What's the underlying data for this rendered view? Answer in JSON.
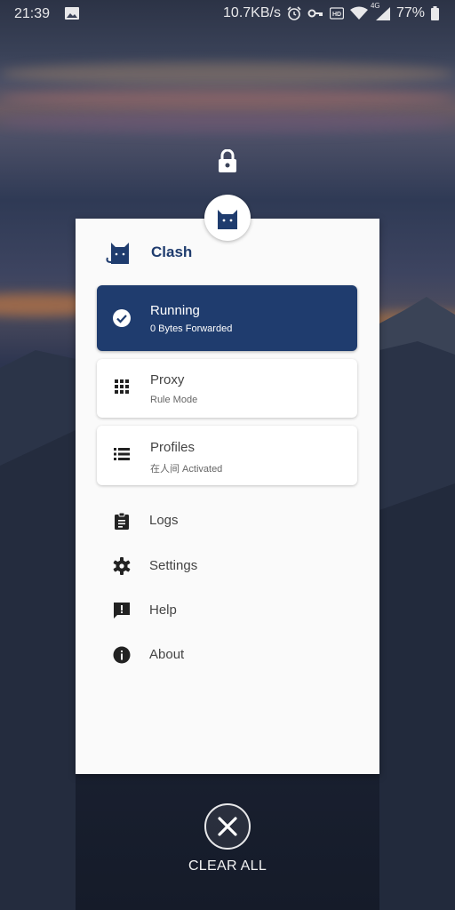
{
  "status_bar": {
    "time": "21:39",
    "network_speed": "10.7KB/s",
    "network_type": "4G",
    "battery": "77%",
    "icons": [
      "image-icon",
      "alarm-icon",
      "vpn-key-icon",
      "hd-icon",
      "wifi-icon",
      "signal-icon",
      "battery-icon"
    ]
  },
  "overview": {
    "lock_icon": "lock-icon",
    "clear_all_label": "CLEAR ALL"
  },
  "app": {
    "title": "Clash",
    "accent_color": "#1f3c6e",
    "status_tile": {
      "title": "Running",
      "subtitle": "0 Bytes Forwarded",
      "icon": "check-circle-icon"
    },
    "proxy_tile": {
      "title": "Proxy",
      "subtitle": "Rule Mode",
      "icon": "grid-icon"
    },
    "profiles_tile": {
      "title": "Profiles",
      "subtitle": "在人间 Activated",
      "icon": "list-icon"
    },
    "menu": [
      {
        "label": "Logs",
        "icon": "clipboard-icon"
      },
      {
        "label": "Settings",
        "icon": "gear-icon"
      },
      {
        "label": "Help",
        "icon": "feedback-icon"
      },
      {
        "label": "About",
        "icon": "info-icon"
      }
    ]
  }
}
